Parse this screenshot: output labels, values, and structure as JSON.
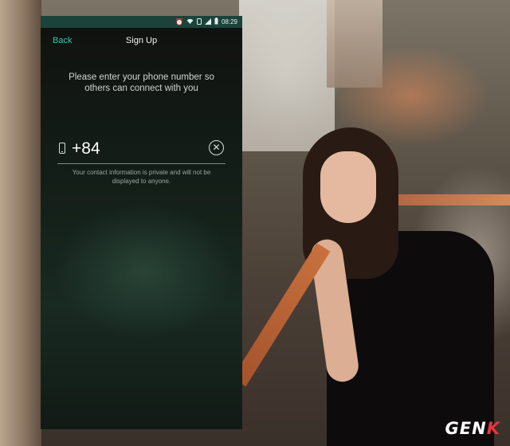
{
  "status_bar": {
    "time": "08:29",
    "icons": [
      "alarm-icon",
      "wifi-icon",
      "sim-icon",
      "signal-icon",
      "battery-icon"
    ]
  },
  "header": {
    "back_label": "Back",
    "title": "Sign Up"
  },
  "prompt": "Please enter your phone number so others can connect with you",
  "phone_field": {
    "value": "+84",
    "clear_icon": "clear-circle-x-icon"
  },
  "privacy_note": "Your contact information is private and will not be displayed to anyone.",
  "watermark": {
    "part1": "GEN",
    "part2": "K"
  },
  "colors": {
    "accent": "#2ec6a8",
    "status_bar": "#1b433a",
    "watermark_accent": "#e8363b"
  }
}
